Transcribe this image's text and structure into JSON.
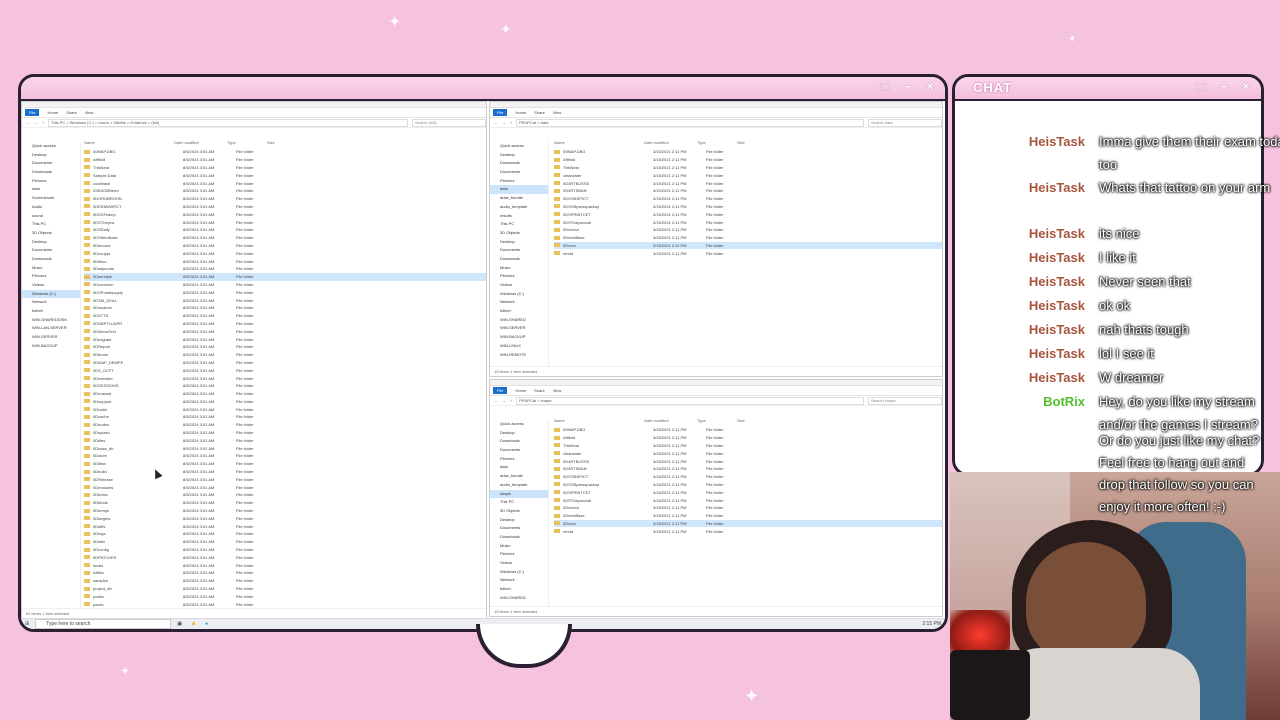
{
  "overlay": {
    "chat_title": "CHAT",
    "window_buttons": [
      "□",
      "–",
      "×"
    ]
  },
  "chat": {
    "messages": [
      {
        "user": "HeisTask",
        "text": "Imma give them their exam today too"
      },
      {
        "user": "HeisTask",
        "text": "Whats that tattoo on your arm"
      },
      {
        "user": "HeisTask",
        "text": "its nice"
      },
      {
        "user": "HeisTask",
        "text": "I like it"
      },
      {
        "user": "HeisTask",
        "text": "Never seen that"
      },
      {
        "user": "HeisTask",
        "text": "ok ok"
      },
      {
        "user": "HeisTask",
        "text": "nah thats tough"
      },
      {
        "user": "HeisTask",
        "text": "lol I see it"
      },
      {
        "user": "HeisTask",
        "text": "W dreamer"
      },
      {
        "user": "BotRix",
        "text": "Hey, do you like my stream and/or the games I stream?"
      }
    ],
    "overflow_lines": [
      "Or do you just like my chat?",
      "Feel free to hang out and",
      "drop that follow so you can",
      "enjoy it more often! ;-)"
    ],
    "colors": {
      "user": "#a8553d",
      "bot": "#53bf2d"
    }
  },
  "explorer_left": {
    "ribbon": [
      "File",
      "Home",
      "Share",
      "View"
    ],
    "address": "This PC > Windows (C:) > Users > Gillette > Evidence > (full)",
    "search": "Search (full)",
    "columns": [
      "Name",
      "Date modified",
      "Type",
      "Size"
    ],
    "nav": [
      "Quick access",
      "Desktop",
      "Documents",
      "Downloads",
      "Pictures",
      "data",
      "Screenshots",
      "Audio",
      "sound",
      "This PC",
      "3D Objects",
      "Desktop",
      "Documents",
      "Downloads",
      "Music",
      "Pictures",
      "Videos",
      "Windows (C:)",
      "Network",
      "fullnet",
      "WIN-SHAREDDISK",
      "WIN-LAN-SERVER",
      "WIN-SERVER",
      "WIN-BACKUP"
    ],
    "rows": [
      "00MAP.DBG",
      "Afitfold",
      "ThisNear",
      "Sample Data",
      "codebase",
      "0SEAOBNeed",
      "0DOROBRGHN",
      "0DEEBMWRCT",
      "0DDSTeamp",
      "0DSTheyea",
      "0DSDaily",
      "0DSItemBase",
      "0Dinvoice",
      "0Docuppr",
      "0Dtilton",
      "0Dwipeouts",
      "0Dsendpie",
      "0Dcommon",
      "0DSPortalsupply",
      "0DSM_DEAL",
      "0Dswarms",
      "0DSTTD",
      "0DNBPTLUAPR",
      "0DMenuGrid",
      "0Dmigrate",
      "0DReport",
      "0Dforum",
      "0DMAP_DBMPE",
      "0DS_OCFT",
      "0Dmember",
      "0DSESSIONS",
      "0Dmanual",
      "0Dsupport",
      "0Dradio",
      "0Dcache",
      "0Dnodes",
      "0Dsplash",
      "0Dtiles",
      "0Dbase_db",
      "0Dstore",
      "0Dlibsc",
      "0Dbuild",
      "0DRelease",
      "0Dmodules",
      "0Dfuncs",
      "0Dbinds",
      "0Dtemps",
      "0Dtargets",
      "0Ddiffs",
      "0Dlogs",
      "0Dwiki",
      "0Dconfig",
      "0DPATCHES",
      "locals",
      "lvlfiles",
      "samples",
      "project_db",
      "pcskin",
      "packs"
    ],
    "selected_row": 16,
    "date": "8/5/2024 3:51 AM",
    "type": "File folder",
    "status": "62 items   1 item selected"
  },
  "explorer_tr": {
    "ribbon": [
      "File",
      "Home",
      "Share",
      "View"
    ],
    "address": "PENPCat > data",
    "search": "Search data",
    "columns": [
      "Name",
      "Date modified",
      "Type",
      "Size"
    ],
    "nav": [
      "Quick access",
      "Desktop",
      "Downloads",
      "Documents",
      "Pictures",
      "data",
      "draw_bundle",
      "audio_template",
      "results",
      "This PC",
      "3D Objects",
      "Desktop",
      "Documents",
      "Downloads",
      "Music",
      "Pictures",
      "Videos",
      "Windows (C:)",
      "Network",
      "fullnet",
      "WIN-SHARED",
      "WIN-SERVER",
      "WIN-BACKUP",
      "WIN-LINUX",
      "WIN-REMOTE"
    ],
    "rows": [
      "00MAP.DBG",
      "Afitfold",
      "ThisNear",
      "clearwater",
      "0D4RTBUSSS",
      "0D4RTSBAN",
      "0DOSBSPICT",
      "0DSOBpresspackup",
      "0DSPRINTCET",
      "0DSTIckpwoodi",
      "0Dvector",
      "0DnewBase",
      "0Dcore",
      "remtd"
    ],
    "selected_row": 12,
    "date": "3/15/2021 2:11 PM",
    "type": "File folder",
    "status": "15 items   1 item selected"
  },
  "explorer_br": {
    "ribbon": [
      "File",
      "Home",
      "Share",
      "View"
    ],
    "address": "PENPCat > shape",
    "search": "Search shape",
    "columns": [
      "Name",
      "Date modified",
      "Type",
      "Size"
    ],
    "nav": [
      "Quick access",
      "Desktop",
      "Downloads",
      "Documents",
      "Pictures",
      "data",
      "draw_bundle",
      "audio_template",
      "shape",
      "This PC",
      "3D Objects",
      "Desktop",
      "Documents",
      "Downloads",
      "Music",
      "Pictures",
      "Videos",
      "Windows (C:)",
      "Network",
      "fullnet",
      "WIN-SHARED"
    ],
    "rows": [
      "00MAP.DBG",
      "Afitfold",
      "ThisNear",
      "clearwater",
      "0D4RTBUSSS",
      "0D4RTSBAN",
      "0DOSBSPICT",
      "0DSOBpresspackup",
      "0DSPRINTCET",
      "0DSTIckpwoodi",
      "0Dvector",
      "0DnewBase",
      "0Dcore",
      "remtd"
    ],
    "selected_row": 12,
    "date": "3/15/2021 2:11 PM",
    "type": "File folder",
    "status": "15 items   1 item selected"
  },
  "taskbar": {
    "search_placeholder": "Type here to search",
    "clock": "2:15 PM"
  }
}
